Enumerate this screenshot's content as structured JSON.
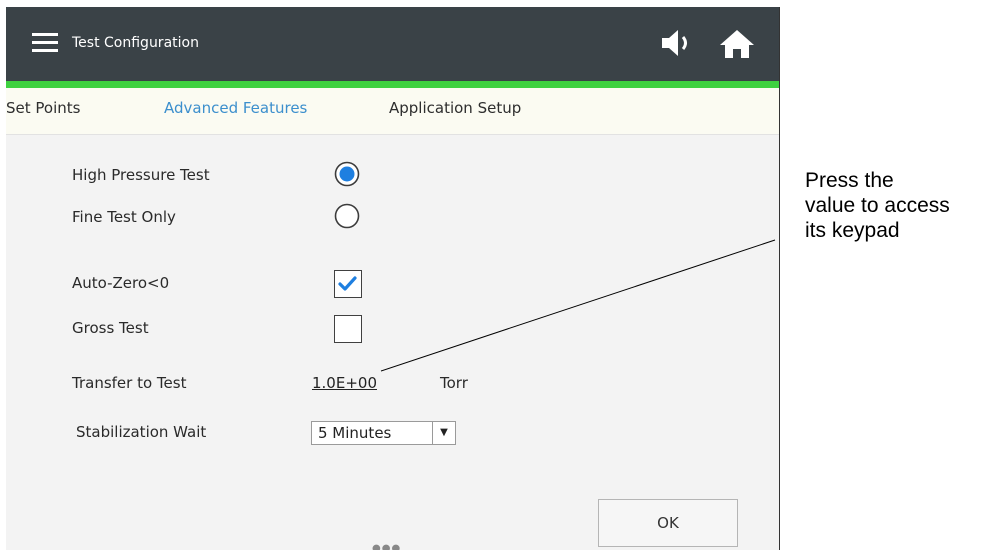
{
  "header": {
    "title": "Test Configuration",
    "menu_icon": "hamburger-menu-icon",
    "speaker_icon": "speaker-icon",
    "home_icon": "home-icon",
    "accent_color": "#3fd140",
    "bar_color": "#3a4247"
  },
  "tabs": [
    {
      "label": "Set Points",
      "active": false
    },
    {
      "label": "Advanced Features",
      "active": true
    },
    {
      "label": "Application Setup",
      "active": false
    }
  ],
  "form": {
    "high_pressure_label": "High Pressure Test",
    "high_pressure_selected": true,
    "fine_test_label": "Fine Test Only",
    "fine_test_selected": false,
    "auto_zero_label": "Auto-Zero<0",
    "auto_zero_checked": true,
    "gross_test_label": "Gross Test",
    "gross_test_checked": false,
    "transfer_label": "Transfer to Test",
    "transfer_value": "1.0E+00",
    "transfer_unit": "Torr",
    "stabilization_label": "Stabilization Wait",
    "stabilization_value": "5 Minutes"
  },
  "ok_label": "OK",
  "callout": {
    "line1": "Press the",
    "line2": "value to access",
    "line3": "its keypad"
  }
}
